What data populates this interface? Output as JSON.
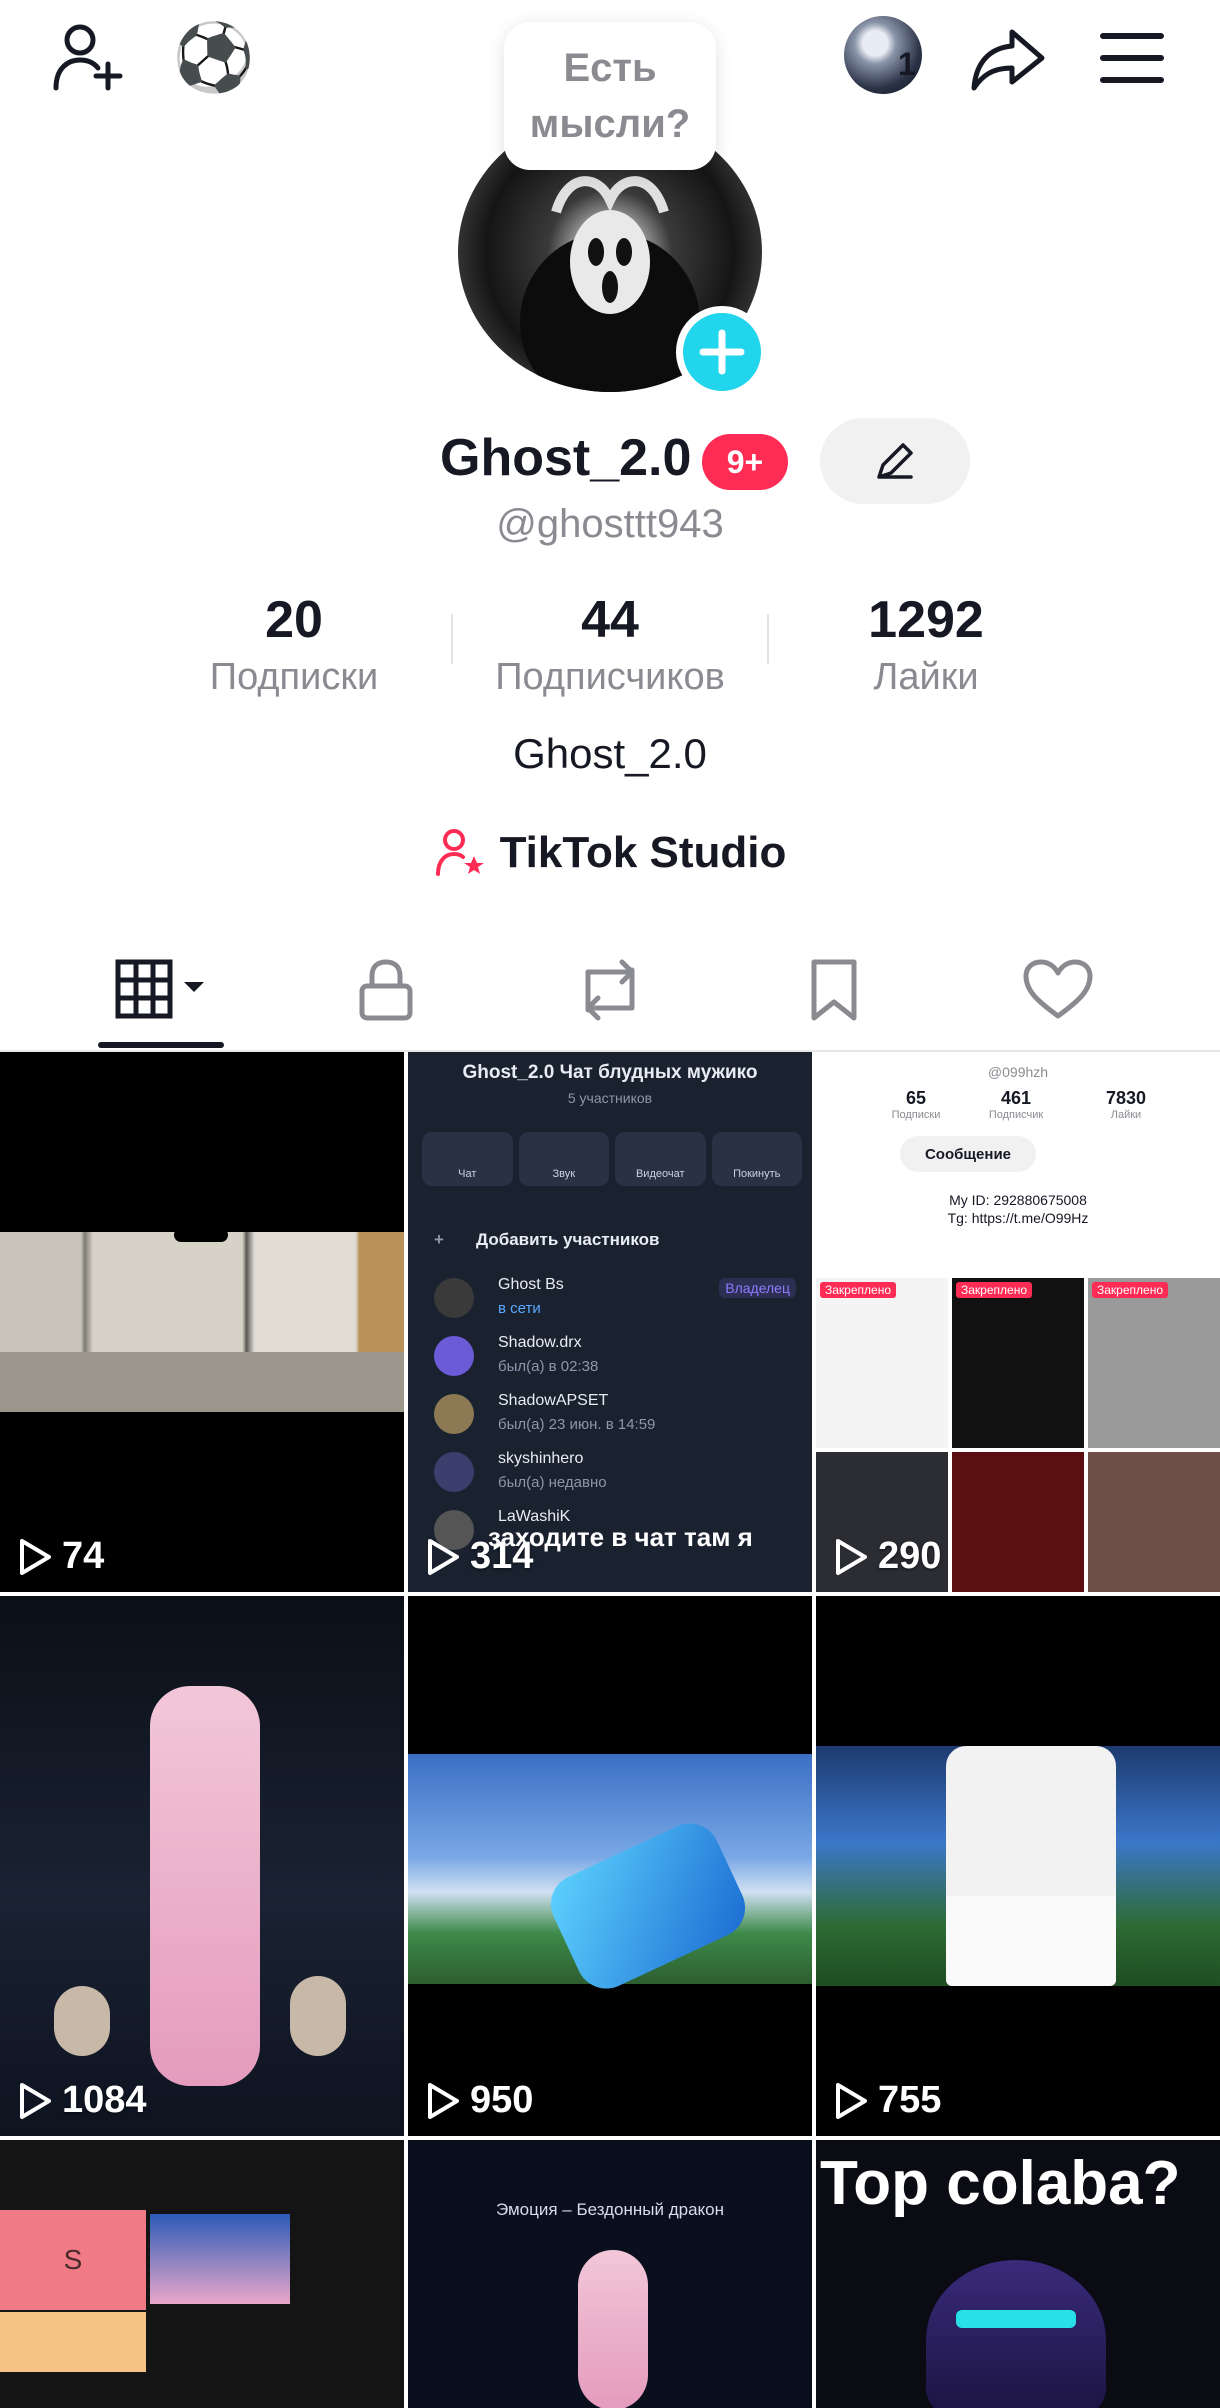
{
  "topbar": {
    "status_emoji": "⚽",
    "notification_count": "1"
  },
  "profile": {
    "thought_bubble": "Есть мысли?",
    "username": "Ghost_2.0",
    "badge": "9+",
    "handle": "@ghosttt943",
    "bio": "Ghost_2.0",
    "studio_label": "TikTok Studio"
  },
  "stats": [
    {
      "value": "20",
      "label": "Подписки"
    },
    {
      "value": "44",
      "label": "Подписчиков"
    },
    {
      "value": "1292",
      "label": "Лайки"
    }
  ],
  "tabs": [
    "videos",
    "private",
    "reposts",
    "favorites",
    "liked"
  ],
  "videos": [
    {
      "views": "74"
    },
    {
      "views": "314"
    },
    {
      "views": "290"
    },
    {
      "views": "1084"
    },
    {
      "views": "950"
    },
    {
      "views": "755"
    },
    {
      "views": ""
    },
    {
      "views": ""
    },
    {
      "views": ""
    }
  ],
  "video_chat": {
    "title": "Ghost_2.0 Чат блудных мужико",
    "subtitle": "5 участников",
    "buttons": [
      "Чат",
      "Звук",
      "Видеочат",
      "Покинуть"
    ],
    "add_label": "Добавить участников",
    "members": [
      {
        "name": "Ghost Bs",
        "status": "в сети",
        "role": "Владелец"
      },
      {
        "name": "Shadow.drx",
        "status": "был(а) в 02:38",
        "role": ""
      },
      {
        "name": "ShadowAPSET",
        "status": "был(а) 23 июн. в 14:59",
        "role": ""
      },
      {
        "name": "skyshinhero",
        "status": "был(а) недавно",
        "role": ""
      },
      {
        "name": "LaWashiK",
        "status": "",
        "role": ""
      }
    ],
    "overlay_text": "заходите в чат там я"
  },
  "video_profile": {
    "handle": "@099hzh",
    "stats": [
      {
        "value": "65",
        "label": "Подписки"
      },
      {
        "value": "461",
        "label": "Подписчик"
      },
      {
        "value": "7830",
        "label": "Лайки"
      }
    ],
    "message_btn": "Сообщение",
    "id_line": "My ID: 292880675008",
    "tg_line": "Tg: https://t.me/O99Hz",
    "pinned_label": "Закреплено"
  },
  "video_tier": {
    "tier": "S"
  },
  "video_emote": {
    "caption": "Эмоция – Бездонный дракон"
  },
  "video_colaba": {
    "caption": "Top colaba?"
  },
  "colors": {
    "accent_cyan": "#20d5ec",
    "accent_red": "#fe2c55",
    "text_primary": "#161823",
    "text_secondary": "#8a8b91"
  }
}
